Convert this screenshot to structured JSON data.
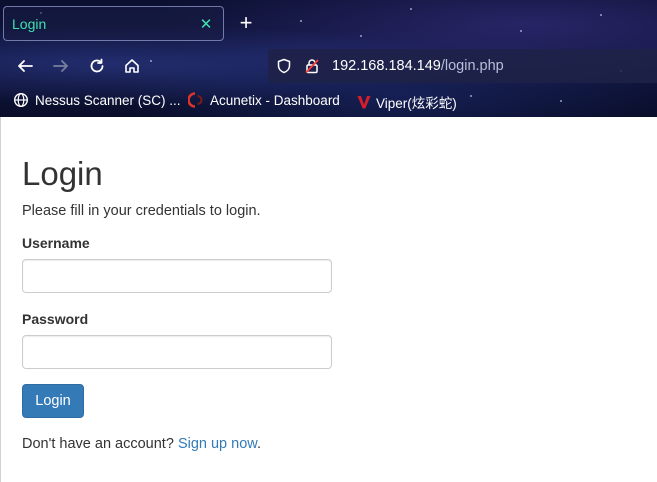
{
  "browser": {
    "tab": {
      "title": "Login",
      "close_glyph": "✕",
      "color": "#3fe1b0"
    },
    "new_tab_glyph": "+",
    "nav": {
      "back_icon": "back-arrow-icon",
      "forward_icon": "forward-arrow-icon",
      "reload_icon": "reload-icon",
      "home_icon": "home-icon"
    },
    "url": {
      "host": "192.168.184.149",
      "path": "/login.php"
    },
    "bookmarks": [
      {
        "label": "Nessus Scanner (SC) ...",
        "icon": "globe-icon"
      },
      {
        "label": "Acunetix - Dashboard",
        "icon": "acunetix-icon"
      },
      {
        "label": "Viper(炫彩蛇)",
        "icon": "viper-v-icon"
      }
    ]
  },
  "page": {
    "title": "Login",
    "subtitle": "Please fill in your credentials to login.",
    "username_label": "Username",
    "username_value": "",
    "password_label": "Password",
    "password_value": "",
    "login_button": "Login",
    "signup_prefix": "Don't have an account?",
    "signup_link": "Sign up now",
    "signup_suffix": "."
  },
  "colors": {
    "accent": "#337ab7",
    "text": "#333333",
    "tab_text": "#3fe1b0"
  }
}
